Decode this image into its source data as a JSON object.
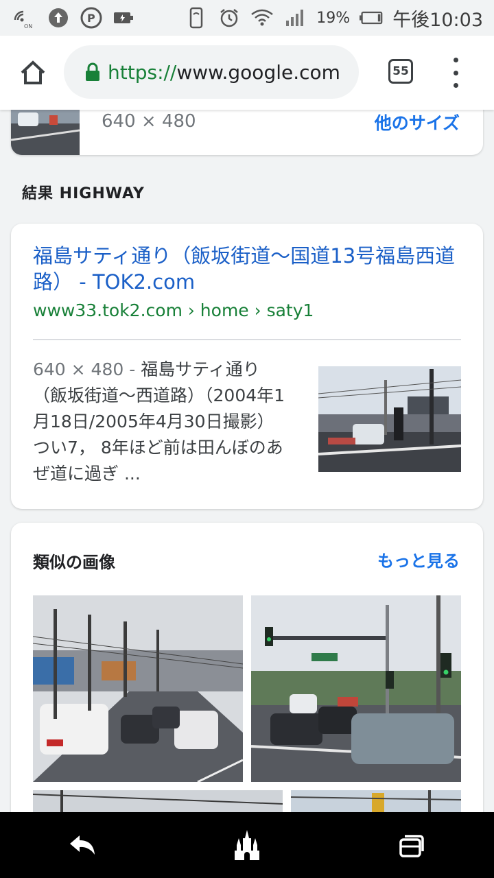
{
  "status_bar": {
    "nfc_label": "ON",
    "battery_percent": "19%",
    "time": "午後10:03"
  },
  "browser": {
    "url_scheme": "https://",
    "url_host": "www.google.com",
    "tab_count": "55"
  },
  "top_result": {
    "size": "640 × 480",
    "more_sizes": "他のサイズ"
  },
  "section_heading": "結果 HIGHWAY",
  "result": {
    "title": "福島サティ通り（飯坂街道〜国道13号福島西道路） - TOK2.com",
    "url": "www33.tok2.com › home › saty1",
    "snippet_size": "640 × 480 - ",
    "snippet": "福島サティ通り（飯坂街道〜西道路）（2004年1月18日/2005年4月30日撮影） つい7， 8年ほど前は田んぼのあぜ道に過ぎ ..."
  },
  "similar": {
    "title": "類似の画像",
    "more": "もっと見る"
  },
  "colors": {
    "link": "#1a5fc7",
    "url_green": "#188038",
    "accent": "#1a73e8"
  },
  "icons": {
    "home": "home-icon",
    "lock": "lock-icon",
    "menu": "more-vert-icon",
    "back": "back-icon",
    "home_nav": "castle-home-icon",
    "recents": "recents-icon"
  }
}
